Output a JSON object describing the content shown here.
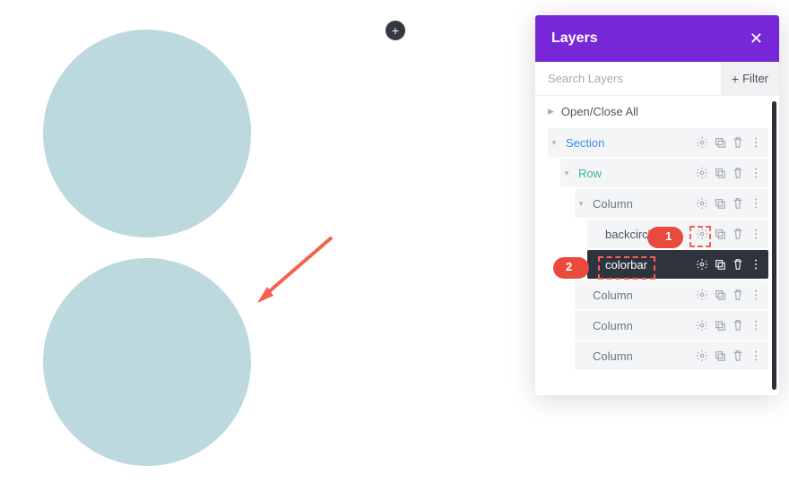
{
  "panel": {
    "title": "Layers",
    "search_placeholder": "Search Layers",
    "filter_label": "Filter",
    "open_close_all": "Open/Close All"
  },
  "tree": {
    "section": "Section",
    "row": "Row",
    "columns": [
      "Column",
      "Column",
      "Column",
      "Column"
    ],
    "modules": {
      "backcircle": "backcircle",
      "colorbar": "colorbar"
    }
  },
  "callouts": {
    "one": "1",
    "two": "2"
  },
  "colors": {
    "header": "#7727d8",
    "circle": "#bcd9de",
    "accent": "#f4624f"
  }
}
